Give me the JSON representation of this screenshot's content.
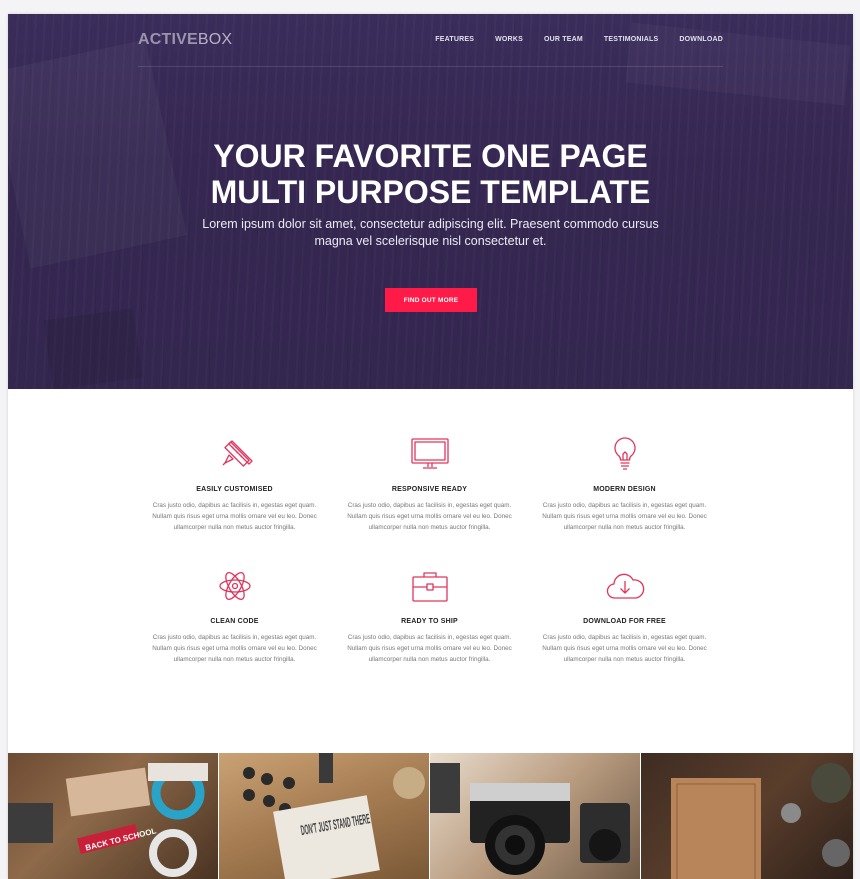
{
  "header": {
    "logo_strong": "ACTIVE",
    "logo_light": "BOX",
    "nav": [
      "FEATURES",
      "WORKS",
      "OUR TEAM",
      "TESTIMONIALS",
      "DOWNLOAD"
    ]
  },
  "hero": {
    "title_line1": "YOUR FAVORITE ONE PAGE",
    "title_line2": "MULTI PURPOSE TEMPLATE",
    "subtitle": "Lorem ipsum dolor sit amet, consectetur adipiscing elit. Praesent commodo cursus magna vel scelerisque nisl consectetur et.",
    "cta_label": "FIND OUT MORE"
  },
  "features": [
    {
      "icon": "pencil-ruler-icon",
      "title": "EASILY CUSTOMISED",
      "text": "Cras justo odio, dapibus ac facilisis in, egestas eget quam. Nullam quis risus eget urna mollis ornare vel eu leo. Donec ullamcorper nulla non metus auctor fringilla."
    },
    {
      "icon": "monitor-icon",
      "title": "RESPONSIVE READY",
      "text": "Cras justo odio, dapibus ac facilisis in, egestas eget quam. Nullam quis risus eget urna mollis ornare vel eu leo. Donec ullamcorper nulla non metus auctor fringilla."
    },
    {
      "icon": "lightbulb-icon",
      "title": "MODERN DESIGN",
      "text": "Cras justo odio, dapibus ac facilisis in, egestas eget quam. Nullam quis risus eget urna mollis ornare vel eu leo. Donec ullamcorper nulla non metus auctor fringilla."
    },
    {
      "icon": "atom-icon",
      "title": "CLEAN CODE",
      "text": "Cras justo odio, dapibus ac facilisis in, egestas eget quam. Nullam quis risus eget urna mollis ornare vel eu leo. Donec ullamcorper nulla non metus auctor fringilla."
    },
    {
      "icon": "briefcase-icon",
      "title": "READY TO SHIP",
      "text": "Cras justo odio, dapibus ac facilisis in, egestas eget quam. Nullam quis risus eget urna mollis ornare vel eu leo. Donec ullamcorper nulla non metus auctor fringilla."
    },
    {
      "icon": "cloud-download-icon",
      "title": "DOWNLOAD FOR FREE",
      "text": "Cras justo odio, dapibus ac facilisis in, egestas eget quam. Nullam quis risus eget urna mollis ornare vel eu leo. Donec ullamcorper nulla non metus auctor fringilla."
    }
  ],
  "colors": {
    "accent": "#ff1a47",
    "icon": "#e0365d",
    "hero_bg": "#352751"
  },
  "gallery": [
    {
      "label": "DON'T JUST STAND THERE"
    },
    {
      "label": "BACK TO SCHOOL"
    }
  ]
}
